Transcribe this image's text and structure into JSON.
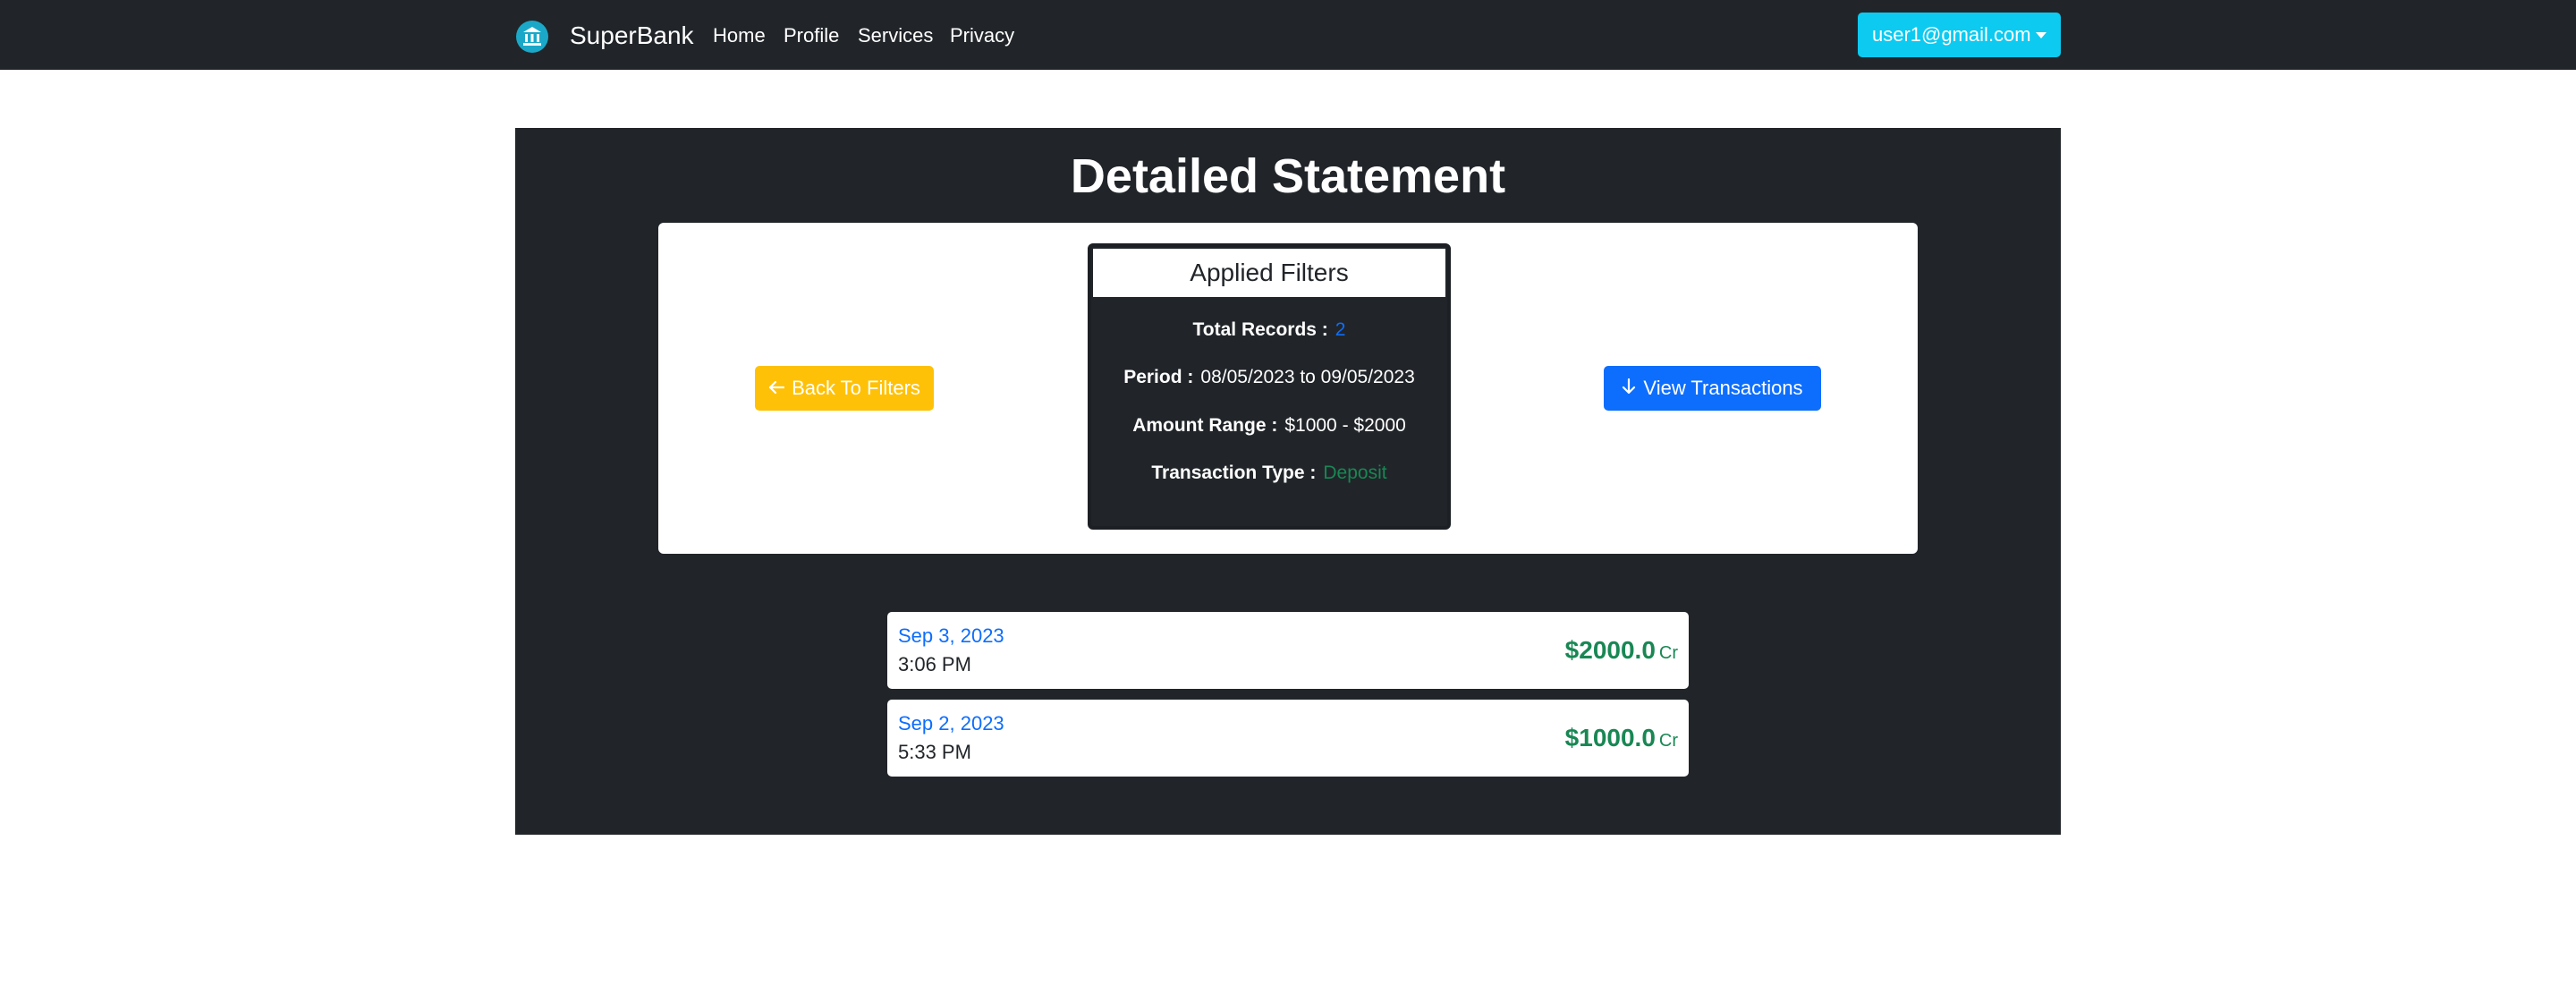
{
  "navbar": {
    "brand": "SuperBank",
    "links": [
      "Home",
      "Profile",
      "Services",
      "Privacy"
    ],
    "user_email": "user1@gmail.com"
  },
  "page": {
    "title": "Detailed Statement"
  },
  "filters": {
    "back_button": "Back To Filters",
    "view_button": "View Transactions",
    "header": "Applied Filters",
    "total_records_label": "Total Records :",
    "total_records_value": "2",
    "period_label": "Period :",
    "period_value": "08/05/2023 to 09/05/2023",
    "amount_range_label": "Amount Range :",
    "amount_range_value": "$1000 - $2000",
    "transaction_type_label": "Transaction Type :",
    "transaction_type_value": "Deposit"
  },
  "transactions": [
    {
      "date": "Sep 3, 2023",
      "time": "3:06 PM",
      "amount": "$2000.0",
      "type": "Cr"
    },
    {
      "date": "Sep 2, 2023",
      "time": "5:33 PM",
      "amount": "$1000.0",
      "type": "Cr"
    }
  ],
  "colors": {
    "navbar_bg": "#212529",
    "accent_info": "#0dcaf0",
    "warning": "#ffc107",
    "primary": "#0d6efd",
    "success": "#198754"
  },
  "icons": {
    "brand": "bank-icon",
    "back": "arrow-left-icon",
    "view": "arrow-down-icon",
    "dropdown": "caret-down-icon"
  }
}
